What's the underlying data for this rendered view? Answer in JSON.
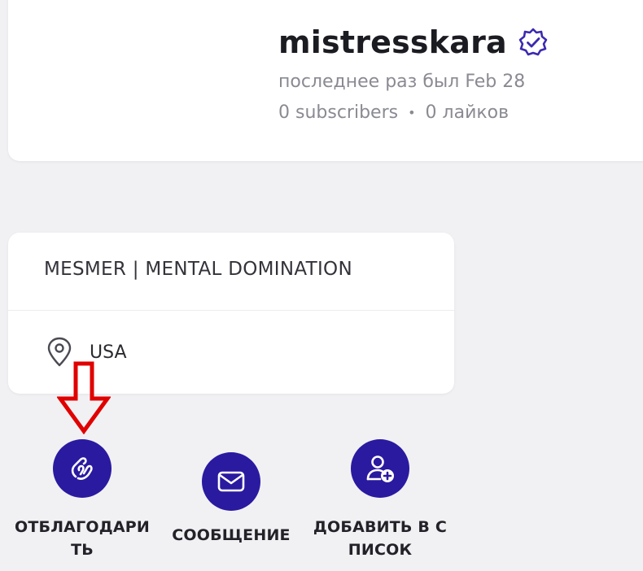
{
  "profile": {
    "username": "mistresskara",
    "last_seen": "последнее раз был Feb 28",
    "subscribers": "0 subscribers",
    "separator": "•",
    "likes": "0 лайков",
    "verified_icon": "verified-badge-icon"
  },
  "info": {
    "bio": "MESMER | MENTAL DOMINATION",
    "location": "USA",
    "location_icon": "map-pin-icon"
  },
  "actions": [
    {
      "icon": "handshake-icon",
      "label_line1": "ОТБЛАГОДАРИ",
      "label_line2": "ТЬ"
    },
    {
      "icon": "envelope-icon",
      "label_line1": "СООБЩЕНИЕ"
    },
    {
      "icon": "add-user-icon",
      "label_line1": "ДОБАВИТЬ В С",
      "label_line2": "ПИСОК"
    }
  ],
  "colors": {
    "accent": "#2a1aa0",
    "annotation_arrow": "#e00000",
    "background": "#f1f1f4",
    "card": "#ffffff"
  }
}
